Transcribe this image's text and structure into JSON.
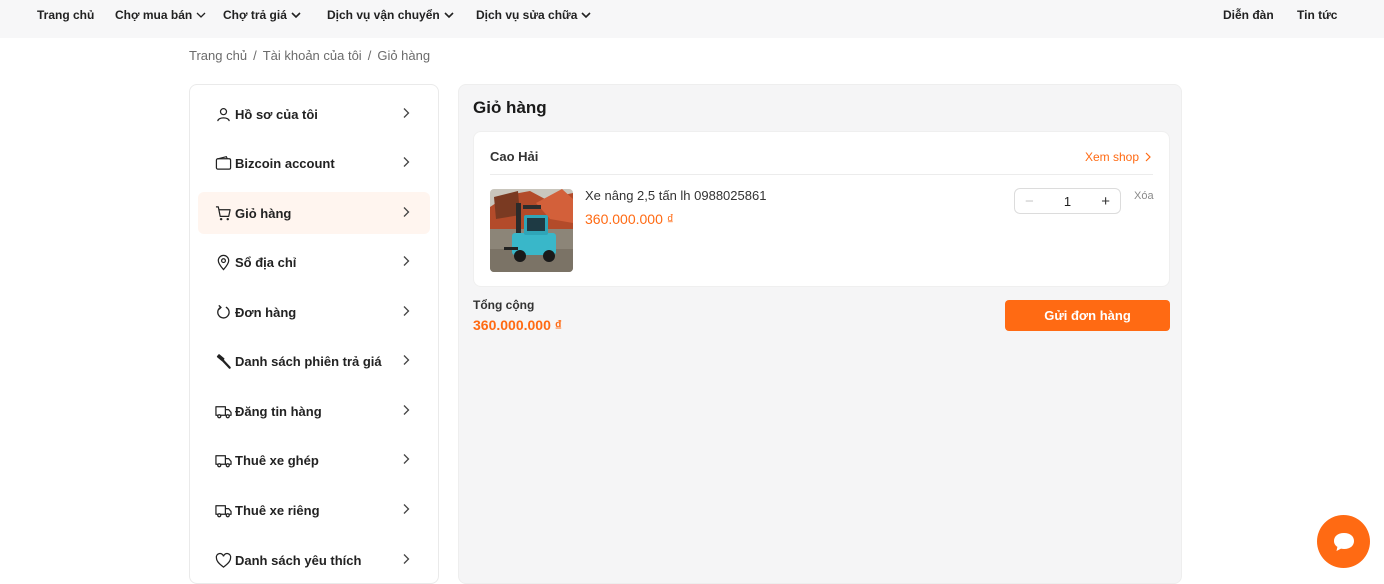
{
  "nav": {
    "items": [
      {
        "label": "Trang chủ",
        "dropdown": false
      },
      {
        "label": "Chợ mua bán",
        "dropdown": true
      },
      {
        "label": "Chợ trả giá",
        "dropdown": true
      },
      {
        "label": "Dịch vụ vận chuyển",
        "dropdown": true
      },
      {
        "label": "Dịch vụ sửa chữa",
        "dropdown": true
      }
    ],
    "right": [
      "Diễn đàn",
      "Tin tức"
    ]
  },
  "breadcrumb": [
    "Trang chủ",
    "Tài khoản của tôi",
    "Giỏ hàng"
  ],
  "breadcrumb_separator": "/",
  "sidebar": {
    "items": [
      {
        "label": "Hồ sơ của tôi",
        "icon": "user-icon"
      },
      {
        "label": "Bizcoin account",
        "icon": "wallet-icon"
      },
      {
        "label": "Giỏ hàng",
        "icon": "cart-icon",
        "active": true
      },
      {
        "label": "Sổ địa chỉ",
        "icon": "map-pin-icon"
      },
      {
        "label": "Đơn hàng",
        "icon": "refresh-icon"
      },
      {
        "label": "Danh sách phiên trả giá",
        "icon": "gavel-icon"
      },
      {
        "label": "Đăng tin hàng",
        "icon": "truck-icon"
      },
      {
        "label": "Thuê xe ghép",
        "icon": "truck-icon"
      },
      {
        "label": "Thuê xe riêng",
        "icon": "truck-icon"
      },
      {
        "label": "Danh sách yêu thích",
        "icon": "heart-icon"
      }
    ]
  },
  "cart": {
    "title": "Giỏ hàng",
    "shop": {
      "name": "Cao Hải",
      "view_label": "Xem shop"
    },
    "item": {
      "name": "Xe nâng 2,5 tấn lh 0988025861",
      "price": "360.000.000 ₫",
      "quantity": "1",
      "minus": "−",
      "plus": "+",
      "remove_label": "Xóa"
    },
    "total_label": "Tổng cộng",
    "total_value": "360.000.000 ₫",
    "submit_label": "Gửi đơn hàng"
  },
  "colors": {
    "accent": "#ff6a13",
    "active_bg": "#fff5ef",
    "panel_bg": "#f5f5f6"
  }
}
